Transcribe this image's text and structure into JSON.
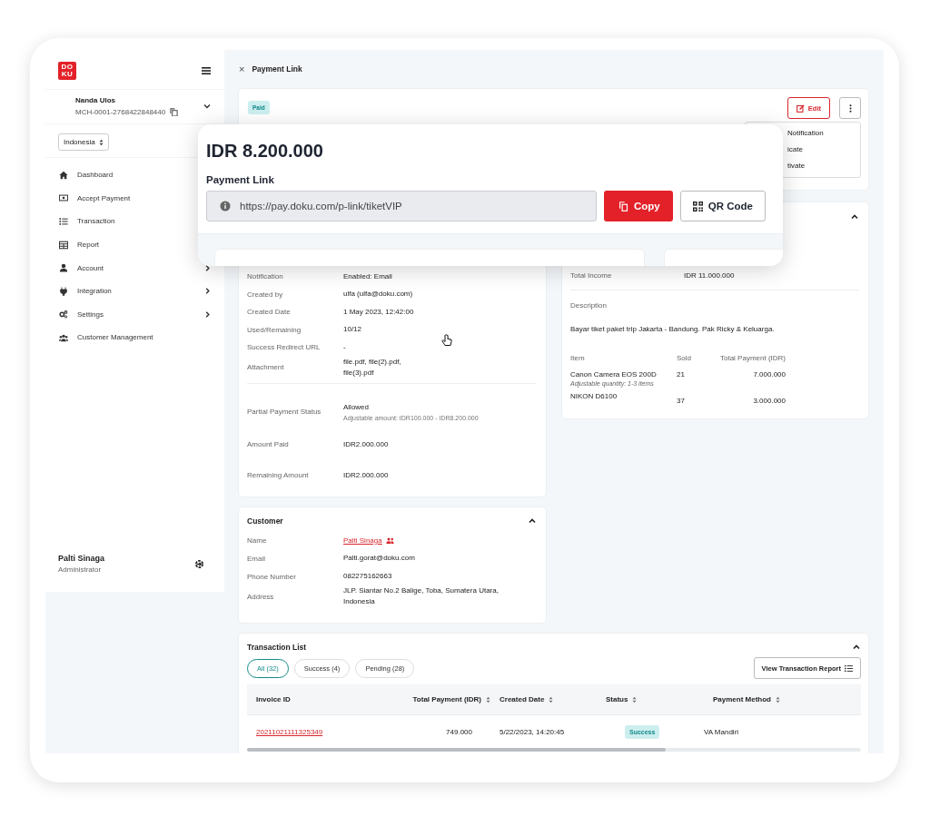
{
  "sidebar": {
    "logo_text": "DOKU",
    "merchant": {
      "name": "Nanda Ulos",
      "id": "MCH-0001-2768422848440",
      "expanded": false
    },
    "country": "Indonesia",
    "items": [
      {
        "label": "Dashboard",
        "selected": false
      },
      {
        "label": "Accept Payment",
        "selected": false
      },
      {
        "label": "Transaction",
        "selected": false
      },
      {
        "label": "Report",
        "selected": false
      },
      {
        "label": "Account",
        "submenu": true,
        "selected": false
      },
      {
        "label": "Integration",
        "submenu": true,
        "selected": false
      },
      {
        "label": "Settings",
        "submenu": true,
        "selected": false
      },
      {
        "label": "Customer Management",
        "submenu": false,
        "selected": false
      }
    ],
    "user": {
      "name": "Palti Sinaga",
      "role": "Administrator"
    }
  },
  "header": {
    "close": "×",
    "title": "Payment Link"
  },
  "summary": {
    "status": "Paid",
    "edit": "Edit",
    "menu": [
      "Notification",
      "icate",
      "tivate"
    ]
  },
  "overlay": {
    "amount": "IDR 8.200.000",
    "label": "Payment Link",
    "url": "https://pay.doku.com/p-link/tiketVIP",
    "copy": "Copy",
    "qr": "QR Code"
  },
  "details": {
    "rows": [
      {
        "label": "Notification",
        "value": "Enabled: Email"
      },
      {
        "label": "Created by",
        "value": "ulfa (ulfa@doku.com)"
      },
      {
        "label": "Created Date",
        "value": "1 May 2023, 12:42:00"
      },
      {
        "label": "Used/Remaining",
        "value": "10/12"
      },
      {
        "label": "Success Redirect URL",
        "value": "-"
      },
      {
        "label": "Attachment",
        "value": "file.pdf, file(2).pdf, file(3).pdf"
      }
    ],
    "partial": {
      "label": "Partial Payment Status",
      "value": "Allowed",
      "note": "Adjustable amount: IDR100.000 - IDR8.200.000"
    },
    "amounts": [
      {
        "label": "Amount Paid",
        "value": "IDR2.000.000"
      },
      {
        "label": "Remaining Amount",
        "value": "IDR2.000.000"
      }
    ]
  },
  "income": {
    "expanded": true,
    "label": "Total Income",
    "value": "IDR 11.000.000",
    "description_label": "Description",
    "description": "Bayar tiket paket trip Jakarta - Bandung. Pak Ricky & Keluarga.",
    "columns": [
      "Item",
      "Sold",
      "Total Payment (IDR)"
    ],
    "rows": [
      {
        "item": "Canon Camera EOS 200D",
        "note": "Adjustable quantity: 1-3 items",
        "sold": "21",
        "total": "7.000.000"
      },
      {
        "item": "NIKON D6100",
        "sold": "37",
        "total": "3.000.000"
      }
    ]
  },
  "customer": {
    "title": "Customer",
    "expanded": true,
    "rows": [
      {
        "label": "Name",
        "value": "Palti Sinaga",
        "kind": "link"
      },
      {
        "label": "Email",
        "value": "Palti.gorat@doku.com",
        "kind": "text"
      },
      {
        "label": "Phone Number",
        "value": "082275162663",
        "kind": "text"
      },
      {
        "label": "Address",
        "value": "JLP. Siantar No.2 Balige, Toba, Sumatera Utara, Indonesia",
        "kind": "text"
      }
    ]
  },
  "transactions": {
    "title": "Transaction List",
    "expanded": true,
    "filters": [
      {
        "label": "All (32)",
        "selected": true
      },
      {
        "label": "Success (4)",
        "selected": false
      },
      {
        "label": "Pending (28)",
        "selected": false
      }
    ],
    "report_button": "View Transaction Report",
    "columns": [
      {
        "label": "Invoice ID",
        "sortable": false
      },
      {
        "label": "Total Payment (IDR)",
        "sortable": true
      },
      {
        "label": "Created Date",
        "sortable": true
      },
      {
        "label": "Status",
        "sortable": true
      },
      {
        "label": "Payment Method",
        "sortable": true
      }
    ],
    "rows": [
      {
        "invoice": "20211021111325349",
        "total": "749.000",
        "date": "5/22/2023, 14:20:45",
        "status": "Success",
        "kind": "success",
        "method": "VA Mandiri"
      }
    ]
  }
}
